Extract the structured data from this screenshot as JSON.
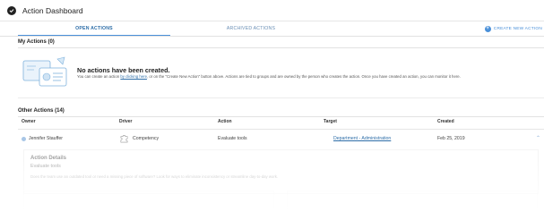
{
  "header": {
    "title": "Action Dashboard",
    "icon": "check-circle-icon"
  },
  "tabs": [
    {
      "label": "OPEN ACTIONS",
      "active": true
    },
    {
      "label": "ARCHIVED ACTIONS",
      "active": false
    }
  ],
  "create_button": {
    "label": "CREATE NEW ACTION",
    "icon": "plus-circle-icon"
  },
  "my_actions": {
    "title": "My Actions (0)",
    "empty_title": "No actions have been created.",
    "empty_body_pre": "You can create an action ",
    "empty_body_link": "by clicking here",
    "empty_body_post": ", or on the \"Create New Action\" button above. Actions are tied to groups and are owned by the person who creates the action. Once you have created an action, you can monitor it here."
  },
  "other_actions": {
    "title": "Other Actions (14)",
    "columns": [
      "Owner",
      "Driver",
      "Action",
      "Target",
      "Created"
    ],
    "rows": [
      {
        "owner": "Jennifer Stauffer",
        "driver": "Competency",
        "driver_icon": "puzzle-icon",
        "action": "Evaluate tools",
        "target": "Department - Administration",
        "created": "Feb 25, 2019"
      }
    ],
    "details": {
      "title": "Action Details",
      "name": "Evaluate tools",
      "description": "Does the team use an outdated tool or need a missing piece of software? Look for ways to eliminate inconsistency or streamline day-to-day work."
    }
  },
  "colors": {
    "accent": "#4a90d9",
    "link": "#2e6ea8"
  }
}
